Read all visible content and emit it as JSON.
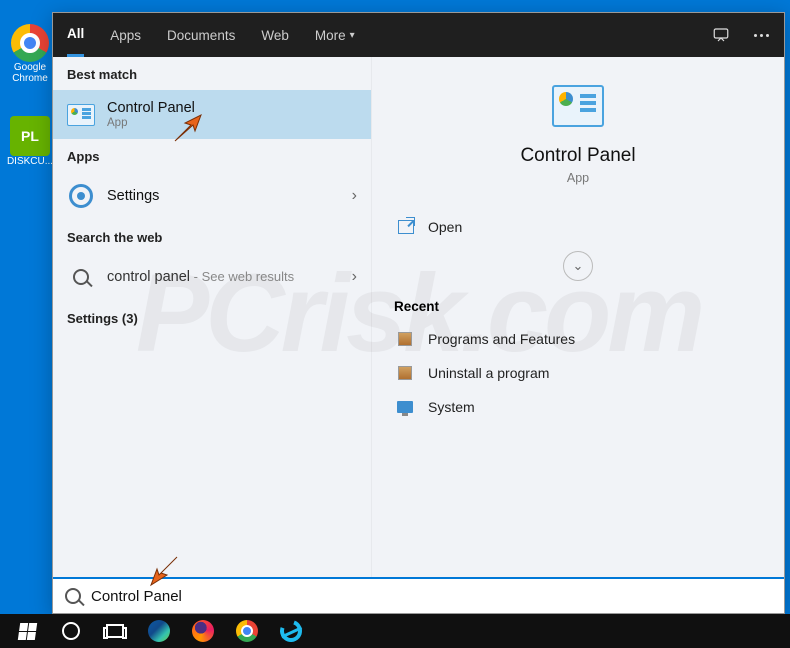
{
  "desktop": {
    "icons": [
      {
        "label": "Google Chrome"
      },
      {
        "label": "DISKCU..."
      }
    ]
  },
  "tabs": {
    "items": [
      "All",
      "Apps",
      "Documents",
      "Web",
      "More"
    ]
  },
  "left": {
    "best_match_header": "Best match",
    "best_match": {
      "title": "Control Panel",
      "subtitle": "App"
    },
    "apps_header": "Apps",
    "apps": [
      {
        "title": "Settings"
      }
    ],
    "web_header": "Search the web",
    "web": {
      "query": "control panel",
      "suffix": " - See web results"
    },
    "settings_header": "Settings (3)"
  },
  "right": {
    "title": "Control Panel",
    "subtitle": "App",
    "open_label": "Open",
    "recent_header": "Recent",
    "recent": [
      {
        "label": "Programs and Features"
      },
      {
        "label": "Uninstall a program"
      },
      {
        "label": "System"
      }
    ]
  },
  "search": {
    "value": "Control Panel"
  },
  "watermark": "PCrisk.com"
}
